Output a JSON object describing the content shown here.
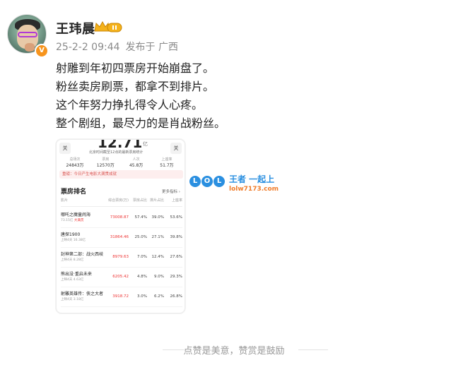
{
  "post": {
    "author": "王玮晨",
    "time": "25-2-2 09:44",
    "source": "发布于 广西",
    "lines": [
      "射雕到年初四票房开始崩盘了。",
      "粉丝卖房刷票，都拿不到排片。",
      "这个年努力挣扎得令人心疼。",
      "整个剧组，最尽力的是肖战粉丝。"
    ],
    "footer": "点赞是美意，赞赏是鼓励"
  },
  "image": {
    "big_number": "12.71",
    "big_unit": "亿",
    "side_left": "关",
    "side_right": "关",
    "subtitle": "北京时间截至12点的最新票房统计",
    "stats": [
      {
        "label": "总场次",
        "value": "24843万"
      },
      {
        "label": "票房",
        "value": "12570万"
      },
      {
        "label": "人次",
        "value": "45.8万"
      },
      {
        "label": "上座率",
        "value": "51.7万"
      }
    ],
    "banner": "重磅：今日产生电影大满贯成就",
    "rank_title": "票房排名",
    "rank_more": "更多指标 ›",
    "headers": [
      "影片",
      "综合票房(万)",
      "票房占比",
      "排片占比",
      "上座率"
    ],
    "rows": [
      {
        "name": "哪吒之魔童闹海",
        "sub": "73.15亿",
        "tag": "大满贯",
        "box": "73008.87",
        "share": "57.4%",
        "sched": "39.0%",
        "occ": "53.6%"
      },
      {
        "name": "唐探1900",
        "sub": "上映4天 16.38亿",
        "tag": "",
        "box": "31864.46",
        "share": "25.0%",
        "sched": "27.1%",
        "occ": "39.8%"
      },
      {
        "name": "封神第二部：战火西岐",
        "sub": "上映4天 8.28亿",
        "tag": "",
        "box": "8979.63",
        "share": "7.0%",
        "sched": "12.4%",
        "occ": "27.6%"
      },
      {
        "name": "熊出没·重启未来",
        "sub": "上映4天 4.63亿",
        "tag": "",
        "box": "6205.42",
        "share": "4.8%",
        "sched": "9.0%",
        "occ": "29.3%"
      },
      {
        "name": "射雕英雄传：侠之大者",
        "sub": "上映4天 3.18亿",
        "tag": "",
        "box": "3918.72",
        "share": "3.0%",
        "sched": "6.2%",
        "occ": "26.8%"
      }
    ]
  },
  "watermark": {
    "letters": [
      "L",
      "O",
      "L"
    ],
    "brand": "王者 一起上",
    "domain": "lolw7173.com"
  },
  "colors": {
    "accent_orange": "#f7941d",
    "watermark_blue": "#2a8fe0",
    "red_value": "#ee3333"
  }
}
